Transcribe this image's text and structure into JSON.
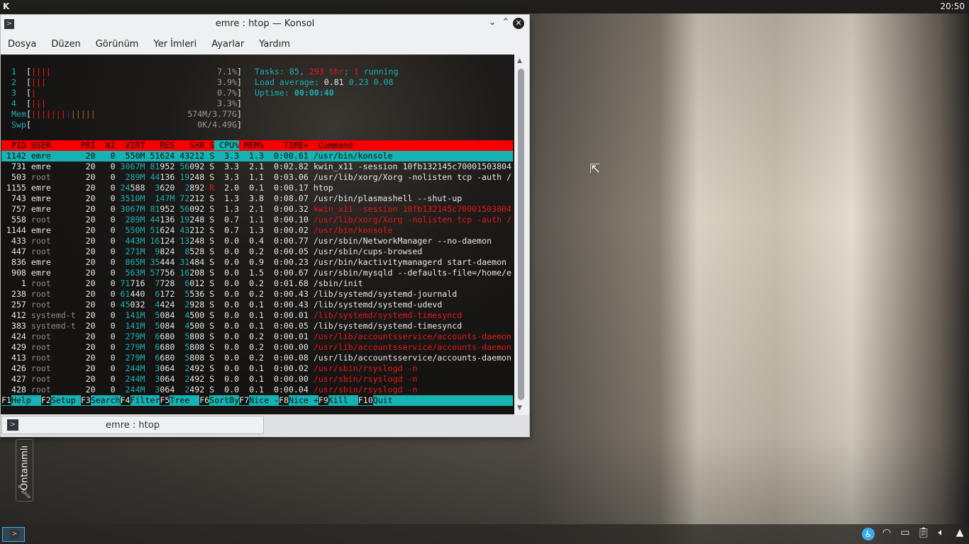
{
  "top_panel": {
    "logo": "K",
    "clock": "20:50"
  },
  "window": {
    "title": "emre : htop — Konsol",
    "menu": [
      "Dosya",
      "Düzen",
      "Görünüm",
      "Yer İmleri",
      "Ayarlar",
      "Yardım"
    ],
    "tab_label": "emre : htop"
  },
  "htop": {
    "cpus": [
      {
        "label": "1",
        "bars": 4,
        "value": "7.1%"
      },
      {
        "label": "2",
        "bars": 3,
        "value": "3.9%"
      },
      {
        "label": "3",
        "bars": 1,
        "value": "0.7%"
      },
      {
        "label": "4",
        "bars": 3,
        "value": "3.3%"
      }
    ],
    "mem": {
      "label": "Mem",
      "used_bars": 7,
      "buffer_bars": 1,
      "cache_bars": 5,
      "value": "574M/3.77G"
    },
    "swp": {
      "label": "Swp",
      "value": "0K/4.49G"
    },
    "tasks": {
      "label": "Tasks: ",
      "count": "85",
      "threads": "293 thr",
      "running": "1",
      "running_label": " running"
    },
    "load": {
      "label": "Load average: ",
      "values": [
        "0.81",
        "0.23",
        "0.08"
      ]
    },
    "uptime": {
      "label": "Uptime: ",
      "value": "00:00:40"
    },
    "columns": [
      "PID",
      "USER",
      "PRI",
      "NI",
      "VIRT",
      "RES",
      "SHR",
      "S",
      "CPU%",
      "MEM%",
      "TIME+",
      "Command"
    ],
    "sort_column": "CPU%",
    "rows": [
      {
        "pid": "1142",
        "user": "emre",
        "pri": "20",
        "ni": "0",
        "virt": "550M",
        "res": "51624",
        "shr": "43212",
        "s": "S",
        "cpu": "3.3",
        "mem": "1.3",
        "time": "0:00.61",
        "cmd": "/usr/bin/konsole",
        "selected": true
      },
      {
        "pid": "731",
        "user": "emre",
        "pri": "20",
        "ni": "0",
        "virt": "3067M",
        "res": "81952",
        "shr": "56092",
        "s": "S",
        "cpu": "3.3",
        "mem": "2.1",
        "time": "0:02.82",
        "cmd": "kwin_x11 -session 10fb132145c70001503804"
      },
      {
        "pid": "503",
        "user": "root",
        "pri": "20",
        "ni": "0",
        "virt": "289M",
        "res": "44136",
        "shr": "19248",
        "s": "S",
        "cpu": "3.3",
        "mem": "1.1",
        "time": "0:03.06",
        "cmd": "/usr/lib/xorg/Xorg -nolisten tcp -auth /"
      },
      {
        "pid": "1155",
        "user": "emre",
        "pri": "20",
        "ni": "0",
        "virt": "24588",
        "res": "3620",
        "shr": "2892",
        "s": "R",
        "cpu": "2.0",
        "mem": "0.1",
        "time": "0:00.17",
        "cmd": "htop"
      },
      {
        "pid": "743",
        "user": "emre",
        "pri": "20",
        "ni": "0",
        "virt": "3510M",
        "res": "147M",
        "shr": "72212",
        "s": "S",
        "cpu": "1.3",
        "mem": "3.8",
        "time": "0:08.07",
        "cmd": "/usr/bin/plasmashell --shut-up"
      },
      {
        "pid": "757",
        "user": "emre",
        "pri": "20",
        "ni": "0",
        "virt": "3067M",
        "res": "81952",
        "shr": "56092",
        "s": "S",
        "cpu": "1.3",
        "mem": "2.1",
        "time": "0:00.32",
        "cmd": "kwin_x11 -session 10fb132145c70001503804",
        "thread": true
      },
      {
        "pid": "558",
        "user": "root",
        "pri": "20",
        "ni": "0",
        "virt": "289M",
        "res": "44136",
        "shr": "19248",
        "s": "S",
        "cpu": "0.7",
        "mem": "1.1",
        "time": "0:00.10",
        "cmd": "/usr/lib/xorg/Xorg -nolisten tcp -auth /",
        "thread": true
      },
      {
        "pid": "1144",
        "user": "emre",
        "pri": "20",
        "ni": "0",
        "virt": "550M",
        "res": "51624",
        "shr": "43212",
        "s": "S",
        "cpu": "0.7",
        "mem": "1.3",
        "time": "0:00.02",
        "cmd": "/usr/bin/konsole",
        "thread": true
      },
      {
        "pid": "433",
        "user": "root",
        "pri": "20",
        "ni": "0",
        "virt": "443M",
        "res": "16124",
        "shr": "13248",
        "s": "S",
        "cpu": "0.0",
        "mem": "0.4",
        "time": "0:00.77",
        "cmd": "/usr/sbin/NetworkManager --no-daemon"
      },
      {
        "pid": "447",
        "user": "root",
        "pri": "20",
        "ni": "0",
        "virt": "271M",
        "res": "9824",
        "shr": "8528",
        "s": "S",
        "cpu": "0.0",
        "mem": "0.2",
        "time": "0:00.05",
        "cmd": "/usr/sbin/cups-browsed"
      },
      {
        "pid": "836",
        "user": "emre",
        "pri": "20",
        "ni": "0",
        "virt": "865M",
        "res": "35444",
        "shr": "31484",
        "s": "S",
        "cpu": "0.0",
        "mem": "0.9",
        "time": "0:00.23",
        "cmd": "/usr/bin/kactivitymanagerd start-daemon"
      },
      {
        "pid": "908",
        "user": "emre",
        "pri": "20",
        "ni": "0",
        "virt": "563M",
        "res": "57756",
        "shr": "16208",
        "s": "S",
        "cpu": "0.0",
        "mem": "1.5",
        "time": "0:00.67",
        "cmd": "/usr/sbin/mysqld --defaults-file=/home/e"
      },
      {
        "pid": "1",
        "user": "root",
        "pri": "20",
        "ni": "0",
        "virt": "71716",
        "res": "7728",
        "shr": "6012",
        "s": "S",
        "cpu": "0.0",
        "mem": "0.2",
        "time": "0:01.68",
        "cmd": "/sbin/init"
      },
      {
        "pid": "238",
        "user": "root",
        "pri": "20",
        "ni": "0",
        "virt": "61440",
        "res": "6172",
        "shr": "5536",
        "s": "S",
        "cpu": "0.0",
        "mem": "0.2",
        "time": "0:00.43",
        "cmd": "/lib/systemd/systemd-journald"
      },
      {
        "pid": "257",
        "user": "root",
        "pri": "20",
        "ni": "0",
        "virt": "45032",
        "res": "4424",
        "shr": "2928",
        "s": "S",
        "cpu": "0.0",
        "mem": "0.1",
        "time": "0:00.43",
        "cmd": "/lib/systemd/systemd-udevd"
      },
      {
        "pid": "412",
        "user": "systemd-t",
        "pri": "20",
        "ni": "0",
        "virt": "141M",
        "res": "5084",
        "shr": "4500",
        "s": "S",
        "cpu": "0.0",
        "mem": "0.1",
        "time": "0:00.01",
        "cmd": "/lib/systemd/systemd-timesyncd",
        "thread": true
      },
      {
        "pid": "383",
        "user": "systemd-t",
        "pri": "20",
        "ni": "0",
        "virt": "141M",
        "res": "5084",
        "shr": "4500",
        "s": "S",
        "cpu": "0.0",
        "mem": "0.1",
        "time": "0:00.05",
        "cmd": "/lib/systemd/systemd-timesyncd"
      },
      {
        "pid": "424",
        "user": "root",
        "pri": "20",
        "ni": "0",
        "virt": "279M",
        "res": "6680",
        "shr": "5808",
        "s": "S",
        "cpu": "0.0",
        "mem": "0.2",
        "time": "0:00.01",
        "cmd": "/usr/lib/accountsservice/accounts-daemon",
        "thread": true
      },
      {
        "pid": "429",
        "user": "root",
        "pri": "20",
        "ni": "0",
        "virt": "279M",
        "res": "6680",
        "shr": "5808",
        "s": "S",
        "cpu": "0.0",
        "mem": "0.2",
        "time": "0:00.00",
        "cmd": "/usr/lib/accountsservice/accounts-daemon",
        "thread": true
      },
      {
        "pid": "413",
        "user": "root",
        "pri": "20",
        "ni": "0",
        "virt": "279M",
        "res": "6680",
        "shr": "5808",
        "s": "S",
        "cpu": "0.0",
        "mem": "0.2",
        "time": "0:00.08",
        "cmd": "/usr/lib/accountsservice/accounts-daemon"
      },
      {
        "pid": "426",
        "user": "root",
        "pri": "20",
        "ni": "0",
        "virt": "244M",
        "res": "3064",
        "shr": "2492",
        "s": "S",
        "cpu": "0.0",
        "mem": "0.1",
        "time": "0:00.02",
        "cmd": "/usr/sbin/rsyslogd -n",
        "thread": true
      },
      {
        "pid": "427",
        "user": "root",
        "pri": "20",
        "ni": "0",
        "virt": "244M",
        "res": "3064",
        "shr": "2492",
        "s": "S",
        "cpu": "0.0",
        "mem": "0.1",
        "time": "0:00.00",
        "cmd": "/usr/sbin/rsyslogd -n",
        "thread": true
      },
      {
        "pid": "428",
        "user": "root",
        "pri": "20",
        "ni": "0",
        "virt": "244M",
        "res": "3064",
        "shr": "2492",
        "s": "S",
        "cpu": "0.0",
        "mem": "0.1",
        "time": "0:00.04",
        "cmd": "/usr/sbin/rsyslogd -n",
        "thread": true
      }
    ],
    "fkeys": [
      {
        "key": "F1",
        "label": "Help  "
      },
      {
        "key": "F2",
        "label": "Setup "
      },
      {
        "key": "F3",
        "label": "Search"
      },
      {
        "key": "F4",
        "label": "Filter"
      },
      {
        "key": "F5",
        "label": "Tree  "
      },
      {
        "key": "F6",
        "label": "SortBy"
      },
      {
        "key": "F7",
        "label": "Nice -"
      },
      {
        "key": "F8",
        "label": "Nice +"
      },
      {
        "key": "F9",
        "label": "Kill  "
      },
      {
        "key": "F10",
        "label": "Quit"
      }
    ]
  },
  "desktop": {
    "widget_label": "Öntanımlı"
  },
  "tray": {
    "icons": [
      "accessibility-icon",
      "wifi-icon",
      "battery-icon",
      "clipboard-icon",
      "volume-icon",
      "expand-tray-icon"
    ]
  }
}
